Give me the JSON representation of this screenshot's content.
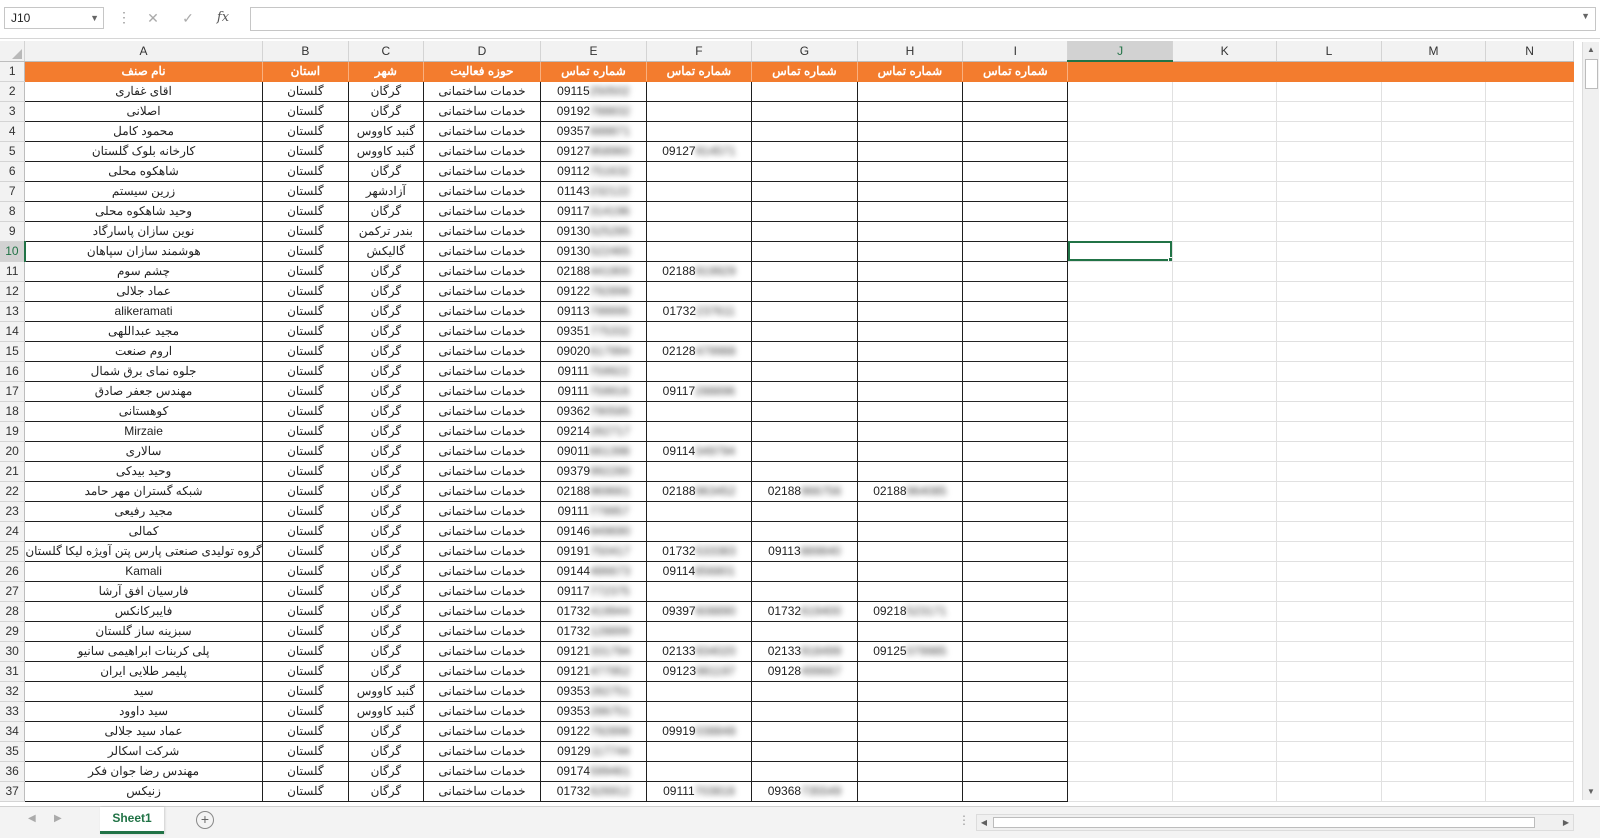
{
  "formula_bar": {
    "name_box": "J10",
    "cancel_icon": "✕",
    "enter_icon": "✓",
    "fx_label": "fx",
    "formula": ""
  },
  "columns": [
    "A",
    "B",
    "C",
    "D",
    "E",
    "F",
    "G",
    "H",
    "I",
    "J",
    "K",
    "L",
    "M",
    "N"
  ],
  "selected_cell": "J10",
  "header_row": [
    "نام صنف",
    "استان",
    "شهر",
    "حوزه فعالیت",
    "شماره تماس",
    "شماره تماس",
    "شماره تماس",
    "شماره تماس",
    "شماره تماس"
  ],
  "rows": [
    {
      "n": "2",
      "a": "اقای غفاری",
      "b": "گلستان",
      "c": "گرگان",
      "d": "خدمات ساختمانی",
      "e": "09115",
      "eh": "250502",
      "f": "",
      "fh": "",
      "g": "",
      "gh": "",
      "h": "",
      "hh": ""
    },
    {
      "n": "3",
      "a": "اصلانی",
      "b": "گلستان",
      "c": "گرگان",
      "d": "خدمات ساختمانی",
      "e": "09192",
      "eh": "788832",
      "f": "",
      "fh": "",
      "g": "",
      "gh": "",
      "h": "",
      "hh": ""
    },
    {
      "n": "4",
      "a": "محمود کامل",
      "b": "گلستان",
      "c": "گنبد کاووس",
      "d": "خدمات ساختمانی",
      "e": "09357",
      "eh": "688871",
      "f": "",
      "fh": "",
      "g": "",
      "gh": "",
      "h": "",
      "hh": ""
    },
    {
      "n": "5",
      "a": "کارخانه بلوک گلستان",
      "b": "گلستان",
      "c": "گنبد کاووس",
      "d": "خدمات ساختمانی",
      "e": "09127",
      "eh": "958960",
      "f": "09127",
      "fh": "914571",
      "g": "",
      "gh": "",
      "h": "",
      "hh": ""
    },
    {
      "n": "6",
      "a": "شاهکوه محلی",
      "b": "گلستان",
      "c": "گرگان",
      "d": "خدمات ساختمانی",
      "e": "09112",
      "eh": "751632",
      "f": "",
      "fh": "",
      "g": "",
      "gh": "",
      "h": "",
      "hh": ""
    },
    {
      "n": "7",
      "a": "زرین سیستم",
      "b": "گلستان",
      "c": "آزادشهر",
      "d": "خدمات ساختمانی",
      "e": "01143",
      "eh": "232122",
      "f": "",
      "fh": "",
      "g": "",
      "gh": "",
      "h": "",
      "hh": ""
    },
    {
      "n": "8",
      "a": "وحید شاهکوه محلی",
      "b": "گلستان",
      "c": "گرگان",
      "d": "خدمات ساختمانی",
      "e": "09117",
      "eh": "314196",
      "f": "",
      "fh": "",
      "g": "",
      "gh": "",
      "h": "",
      "hh": ""
    },
    {
      "n": "9",
      "a": "نوین سازان پاسارگاد",
      "b": "گلستان",
      "c": "بندر ترکمن",
      "d": "خدمات ساختمانی",
      "e": "09130",
      "eh": "525285",
      "f": "",
      "fh": "",
      "g": "",
      "gh": "",
      "h": "",
      "hh": ""
    },
    {
      "n": "10",
      "a": "هوشمند سازان سپاهان",
      "b": "گلستان",
      "c": "گالیکش",
      "d": "خدمات ساختمانی",
      "e": "09130",
      "eh": "522465",
      "f": "",
      "fh": "",
      "g": "",
      "gh": "",
      "h": "",
      "hh": ""
    },
    {
      "n": "11",
      "a": "چشم سوم",
      "b": "گلستان",
      "c": "گرگان",
      "d": "خدمات ساختمانی",
      "e": "02188",
      "eh": "441900",
      "f": "02188",
      "fh": "919929",
      "g": "",
      "gh": "",
      "h": "",
      "hh": ""
    },
    {
      "n": "12",
      "a": "عماد جلالی",
      "b": "گلستان",
      "c": "گرگان",
      "d": "خدمات ساختمانی",
      "e": "09122",
      "eh": "792898",
      "f": "",
      "fh": "",
      "g": "",
      "gh": "",
      "h": "",
      "hh": ""
    },
    {
      "n": "13",
      "a": "alikeramati",
      "b": "گلستان",
      "c": "گرگان",
      "d": "خدمات ساختمانی",
      "e": "09113",
      "eh": "799995",
      "f": "01732",
      "fh": "237611",
      "g": "",
      "gh": "",
      "h": "",
      "hh": ""
    },
    {
      "n": "14",
      "a": "مجید عبداللهی",
      "b": "گلستان",
      "c": "گرگان",
      "d": "خدمات ساختمانی",
      "e": "09351",
      "eh": "775332",
      "f": "",
      "fh": "",
      "g": "",
      "gh": "",
      "h": "",
      "hh": ""
    },
    {
      "n": "15",
      "a": "اروم صنعت",
      "b": "گلستان",
      "c": "گرگان",
      "d": "خدمات ساختمانی",
      "e": "09020",
      "eh": "617994",
      "f": "02128",
      "fh": "479988",
      "g": "",
      "gh": "",
      "h": "",
      "hh": ""
    },
    {
      "n": "16",
      "a": "جلوه نمای برق شمال",
      "b": "گلستان",
      "c": "گرگان",
      "d": "خدمات ساختمانی",
      "e": "09111",
      "eh": "759922",
      "f": "",
      "fh": "",
      "g": "",
      "gh": "",
      "h": "",
      "hh": ""
    },
    {
      "n": "17",
      "a": "مهندس جعفر صادق",
      "b": "گلستان",
      "c": "گرگان",
      "d": "خدمات ساختمانی",
      "e": "09111",
      "eh": "759916",
      "f": "09117",
      "fh": "288896",
      "g": "",
      "gh": "",
      "h": "",
      "hh": ""
    },
    {
      "n": "18",
      "a": "کوهستانی",
      "b": "گلستان",
      "c": "گرگان",
      "d": "خدمات ساختمانی",
      "e": "09362",
      "eh": "790585",
      "f": "",
      "fh": "",
      "g": "",
      "gh": "",
      "h": "",
      "hh": ""
    },
    {
      "n": "19",
      "a": "Mirzaie",
      "b": "گلستان",
      "c": "گرگان",
      "d": "خدمات ساختمانی",
      "e": "09214",
      "eh": "282717",
      "f": "",
      "fh": "",
      "g": "",
      "gh": "",
      "h": "",
      "hh": ""
    },
    {
      "n": "20",
      "a": "سالاری",
      "b": "گلستان",
      "c": "گرگان",
      "d": "خدمات ساختمانی",
      "e": "09011",
      "eh": "661398",
      "f": "09114",
      "fh": "349794",
      "g": "",
      "gh": "",
      "h": "",
      "hh": ""
    },
    {
      "n": "21",
      "a": "وحید بیدکی",
      "b": "گلستان",
      "c": "گرگان",
      "d": "خدمات ساختمانی",
      "e": "09379",
      "eh": "992280",
      "f": "",
      "fh": "",
      "g": "",
      "gh": "",
      "h": "",
      "hh": ""
    },
    {
      "n": "22",
      "a": "شبکه گستران مهر حامد",
      "b": "گلستان",
      "c": "گرگان",
      "d": "خدمات ساختمانی",
      "e": "02188",
      "eh": "969661",
      "f": "02188",
      "fh": "963452",
      "g": "02188",
      "gh": "966756",
      "h": "02188",
      "hh": "964085"
    },
    {
      "n": "23",
      "a": "مجید رفیعی",
      "b": "گلستان",
      "c": "گرگان",
      "d": "خدمات ساختمانی",
      "e": "09111",
      "eh": "779957",
      "f": "",
      "fh": "",
      "g": "",
      "gh": "",
      "h": "",
      "hh": ""
    },
    {
      "n": "24",
      "a": "کمالی",
      "b": "گلستان",
      "c": "گرگان",
      "d": "خدمات ساختمانی",
      "e": "09146",
      "eh": "949690",
      "f": "",
      "fh": "",
      "g": "",
      "gh": "",
      "h": "",
      "hh": ""
    },
    {
      "n": "25",
      "a": "گروه تولیدی صنعتی پارس پتن آویژه لیکا گلستان",
      "b": "گلستان",
      "c": "گرگان",
      "d": "خدمات ساختمانی",
      "e": "09191",
      "eh": "750417",
      "f": "01732",
      "fh": "533383",
      "g": "09113",
      "gh": "889840",
      "h": "",
      "hh": ""
    },
    {
      "n": "26",
      "a": "Kamali",
      "b": "گلستان",
      "c": "گرگان",
      "d": "خدمات ساختمانی",
      "e": "09144",
      "eh": "486673",
      "f": "09114",
      "fh": "856801",
      "g": "",
      "gh": "",
      "h": "",
      "hh": ""
    },
    {
      "n": "27",
      "a": "فارسیان افق آرشا",
      "b": "گلستان",
      "c": "گرگان",
      "d": "خدمات ساختمانی",
      "e": "09117",
      "eh": "772375",
      "f": "",
      "fh": "",
      "g": "",
      "gh": "",
      "h": "",
      "hh": ""
    },
    {
      "n": "28",
      "a": "فایبرکانکس",
      "b": "گلستان",
      "c": "گرگان",
      "d": "خدمات ساختمانی",
      "e": "01732",
      "eh": "419944",
      "f": "09397",
      "fh": "608890",
      "g": "01732",
      "gh": "619400",
      "h": "09218",
      "hh": "523171"
    },
    {
      "n": "29",
      "a": "سبزینه ساز گلستان",
      "b": "گلستان",
      "c": "گرگان",
      "d": "خدمات ساختمانی",
      "e": "01732",
      "eh": "128899",
      "f": "",
      "fh": "",
      "g": "",
      "gh": "",
      "h": "",
      "hh": ""
    },
    {
      "n": "30",
      "a": "پلی کربنات ابراهیمی سانیو",
      "b": "گلستان",
      "c": "گرگان",
      "d": "خدمات ساختمانی",
      "e": "09121",
      "eh": "331794",
      "f": "02133",
      "fh": "934020",
      "g": "02133",
      "gh": "918499",
      "h": "09125",
      "hh": "079985"
    },
    {
      "n": "31",
      "a": "پلیمر طلایی ایران",
      "b": "گلستان",
      "c": "گرگان",
      "d": "خدمات ساختمانی",
      "e": "09121",
      "eh": "477952",
      "f": "09123",
      "fh": "981197",
      "g": "09128",
      "gh": "499667",
      "h": "",
      "hh": ""
    },
    {
      "n": "32",
      "a": "سید",
      "b": "گلستان",
      "c": "گنبد کاووس",
      "d": "خدمات ساختمانی",
      "e": "09353",
      "eh": "282751",
      "f": "",
      "fh": "",
      "g": "",
      "gh": "",
      "h": "",
      "hh": ""
    },
    {
      "n": "33",
      "a": "سید داوود",
      "b": "گلستان",
      "c": "گنبد کاووس",
      "d": "خدمات ساختمانی",
      "e": "09353",
      "eh": "286751",
      "f": "",
      "fh": "",
      "g": "",
      "gh": "",
      "h": "",
      "hh": ""
    },
    {
      "n": "34",
      "a": "عماد سید جلالی",
      "b": "گلستان",
      "c": "گرگان",
      "d": "خدمات ساختمانی",
      "e": "09122",
      "eh": "792898",
      "f": "09919",
      "fh": "038848",
      "g": "",
      "gh": "",
      "h": "",
      "hh": ""
    },
    {
      "n": "35",
      "a": "شرکت اسکالر",
      "b": "گلستان",
      "c": "گرگان",
      "d": "خدمات ساختمانی",
      "e": "09129",
      "eh": "117744",
      "f": "",
      "fh": "",
      "g": "",
      "gh": "",
      "h": "",
      "hh": ""
    },
    {
      "n": "36",
      "a": "مهندس رضا جوان فکر",
      "b": "گلستان",
      "c": "گرگان",
      "d": "خدمات ساختمانی",
      "e": "09174",
      "eh": "599461",
      "f": "",
      "fh": "",
      "g": "",
      "gh": "",
      "h": "",
      "hh": ""
    },
    {
      "n": "37",
      "a": "زنیکس",
      "b": "گلستان",
      "c": "گرگان",
      "d": "خدمات ساختمانی",
      "e": "01732",
      "eh": "626912",
      "f": "09111",
      "fh": "703818",
      "g": "09368",
      "gh": "735549",
      "h": "",
      "hh": ""
    }
  ],
  "first_row_number": "1",
  "sheet_tab": "Sheet1",
  "add_sheet_icon": "+",
  "colors": {
    "header_fill": "#f37c2e",
    "accent": "#217346"
  }
}
